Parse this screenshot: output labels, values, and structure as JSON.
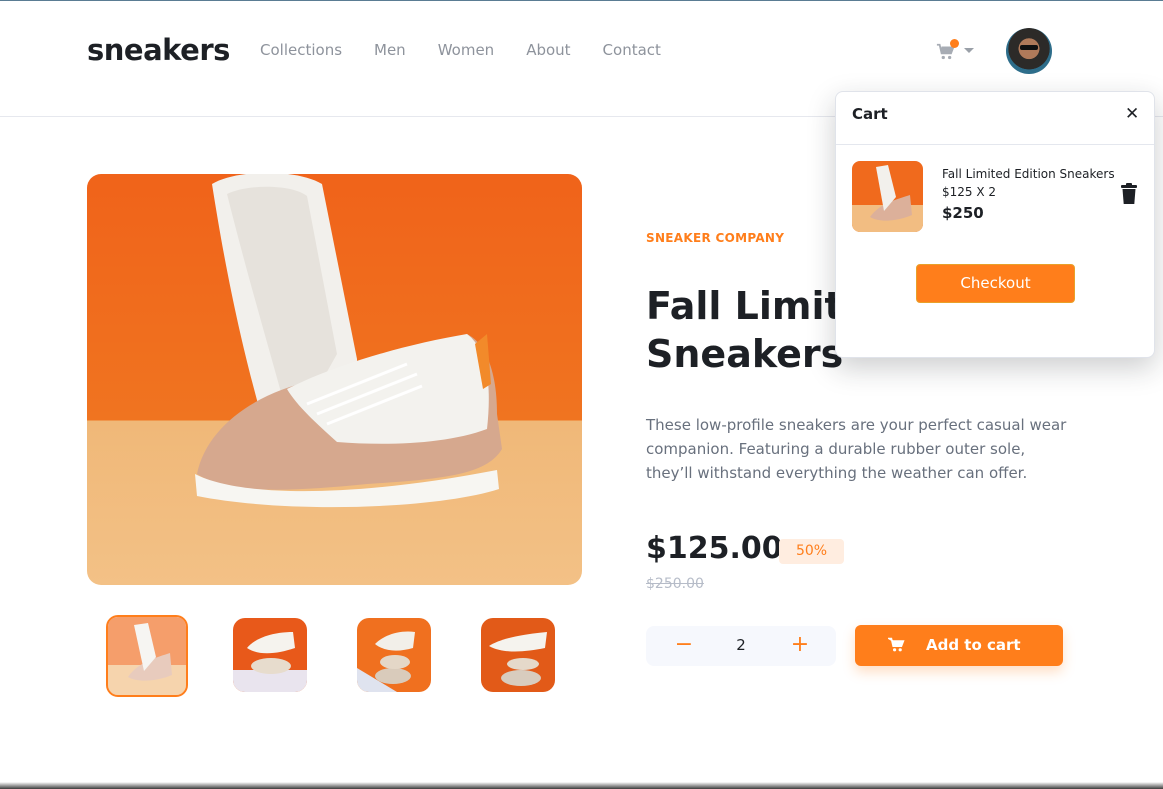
{
  "brand": {
    "logo": "sneakers"
  },
  "nav": {
    "items": [
      "Collections",
      "Men",
      "Women",
      "About",
      "Contact"
    ]
  },
  "header": {
    "cart_badge": "",
    "cart_icon": "cart-icon",
    "avatar": "avatar"
  },
  "product": {
    "company": "SNEAKER COMPANY",
    "title_line1": "Fall Limited Edition",
    "title_line2": "Sneakers",
    "description": "These low-profile sneakers are your perfect casual wear companion. Featuring a durable rubber outer sole, they’ll withstand everything the weather can offer.",
    "price": "$125.00",
    "discount": "50%",
    "old_price": "$250.00",
    "quantity": "2",
    "minus": "−",
    "plus": "+",
    "add_to_cart": "Add to cart"
  },
  "cart": {
    "title": "Cart",
    "close": "✕",
    "item_name": "Fall Limited Edition Sneakers",
    "item_qty": "$125 X 2",
    "item_total": "$250",
    "checkout": "Checkout"
  },
  "colors": {
    "accent": "#ff7e1b",
    "dark": "#1d2025",
    "muted": "#68707d",
    "pale_orange": "#ffede0"
  }
}
